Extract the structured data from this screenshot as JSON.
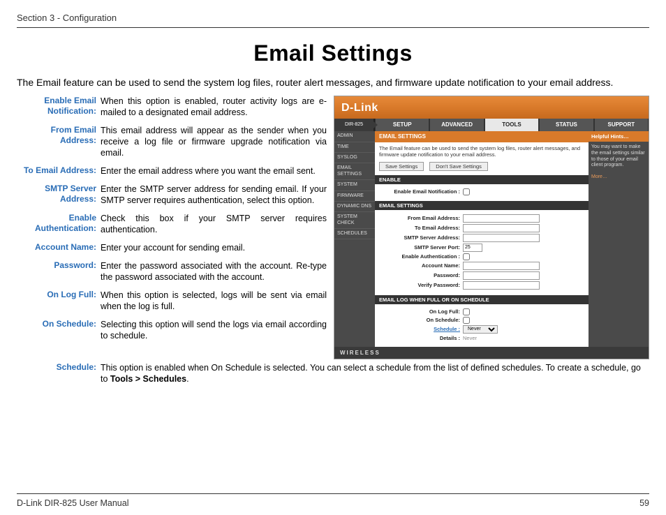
{
  "header": {
    "section": "Section 3 - Configuration"
  },
  "title": "Email Settings",
  "intro": "The Email feature can be used to send the system log files, router alert messages, and firmware update notification to your email address.",
  "defs": [
    {
      "label": "Enable Email Notification:",
      "body": "When this option is enabled, router activity logs are e-mailed to a designated email address."
    },
    {
      "label": "From Email Address:",
      "body": "This email address will appear as the sender when you receive a log file or firmware upgrade notification via email."
    },
    {
      "label": "To Email Address:",
      "body": "Enter the email address where you want the email sent."
    },
    {
      "label": "SMTP Server Address:",
      "body": "Enter the SMTP server address for sending email. If your SMTP server requires authentication, select this option."
    },
    {
      "label": "Enable Authentication:",
      "body": "Check this box if your SMTP server requires authentication."
    },
    {
      "label": "Account Name:",
      "body": "Enter your account for sending email."
    },
    {
      "label": "Password:",
      "body": "Enter the password associated with the account. Re-type the password associated with the account."
    },
    {
      "label": "On Log Full:",
      "body": "When this option is selected, logs will be sent via email when the log is full."
    },
    {
      "label": "On Schedule:",
      "body": "Selecting this option will send the logs via email according to schedule."
    }
  ],
  "schedule_def": {
    "label": "Schedule:",
    "body_prefix": "This option is enabled when On Schedule is selected. You can select a schedule from the list of defined schedules. To create a schedule, go to ",
    "body_bold": "Tools > Schedules",
    "body_suffix": "."
  },
  "router": {
    "brand": "D-Link",
    "model": "DIR-825",
    "tabs": [
      "SETUP",
      "ADVANCED",
      "TOOLS",
      "STATUS",
      "SUPPORT"
    ],
    "active_tab": "TOOLS",
    "sidebar": [
      "ADMIN",
      "TIME",
      "SYSLOG",
      "EMAIL SETTINGS",
      "SYSTEM",
      "FIRMWARE",
      "DYNAMIC DNS",
      "SYSTEM CHECK",
      "SCHEDULES"
    ],
    "page_heading": "EMAIL SETTINGS",
    "page_desc": "The Email feature can be used to send the system log files, router alert messages, and firmware update notification to your email address.",
    "buttons": {
      "save": "Save Settings",
      "dont": "Don't Save Settings"
    },
    "sections": {
      "enable": "ENABLE",
      "email_settings": "EMAIL SETTINGS",
      "email_log": "EMAIL LOG WHEN FULL OR ON SCHEDULE"
    },
    "fields": {
      "enable_notif": "Enable Email Notification :",
      "from": "From Email Address:",
      "to": "To Email Address:",
      "smtp_addr": "SMTP Server Address:",
      "smtp_port": "SMTP Server Port:",
      "smtp_port_val": "25",
      "enable_auth": "Enable Authentication :",
      "account": "Account Name:",
      "password": "Password:",
      "verify": "Verify Password:",
      "on_log_full": "On Log Full:",
      "on_schedule": "On Schedule:",
      "schedule": "Schedule :",
      "schedule_val": "Never",
      "details": "Details :",
      "details_val": "Never"
    },
    "hints": {
      "heading": "Helpful Hints…",
      "body": "You may want to make the email settings similar to those of your email client program.",
      "more": "More…"
    },
    "footer": "WIRELESS"
  },
  "footer": {
    "manual": "D-Link DIR-825 User Manual",
    "page": "59"
  }
}
